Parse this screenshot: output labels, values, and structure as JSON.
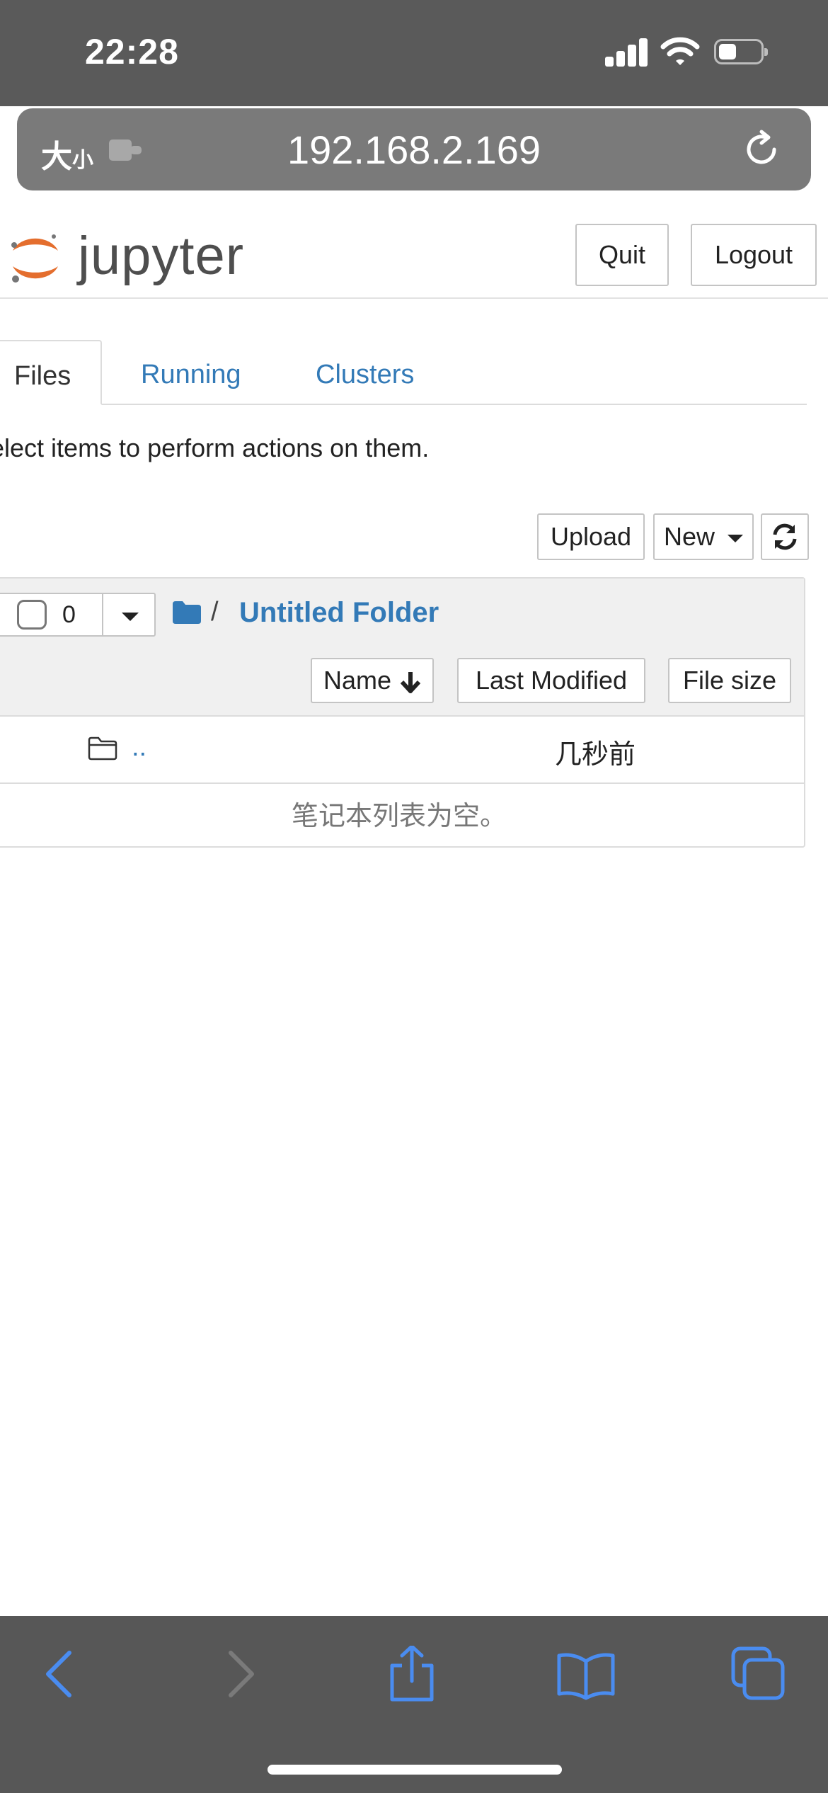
{
  "status_bar": {
    "time": "22:28"
  },
  "browser": {
    "text_size_large": "大",
    "text_size_small": "小",
    "address": "192.168.2.169"
  },
  "header": {
    "logo_text": "jupyter",
    "quit_label": "Quit",
    "logout_label": "Logout"
  },
  "tabs": [
    {
      "label": "Files",
      "active": true
    },
    {
      "label": "Running",
      "active": false
    },
    {
      "label": "Clusters",
      "active": false
    }
  ],
  "instruction": "elect items to perform actions on them.",
  "actions": {
    "upload_label": "Upload",
    "new_label": "New"
  },
  "listing": {
    "selected_count": "0",
    "breadcrumb_sep": "/",
    "current_folder": "Untitled Folder",
    "columns": {
      "name": "Name",
      "modified": "Last Modified",
      "size": "File size"
    },
    "parent_row": {
      "name": "..",
      "modified": "几秒前"
    },
    "empty_message": "笔记本列表为空。"
  },
  "colors": {
    "link": "#337ab7",
    "ios_accent": "#4a8cf0",
    "chrome_bg": "#5a5a5a"
  }
}
